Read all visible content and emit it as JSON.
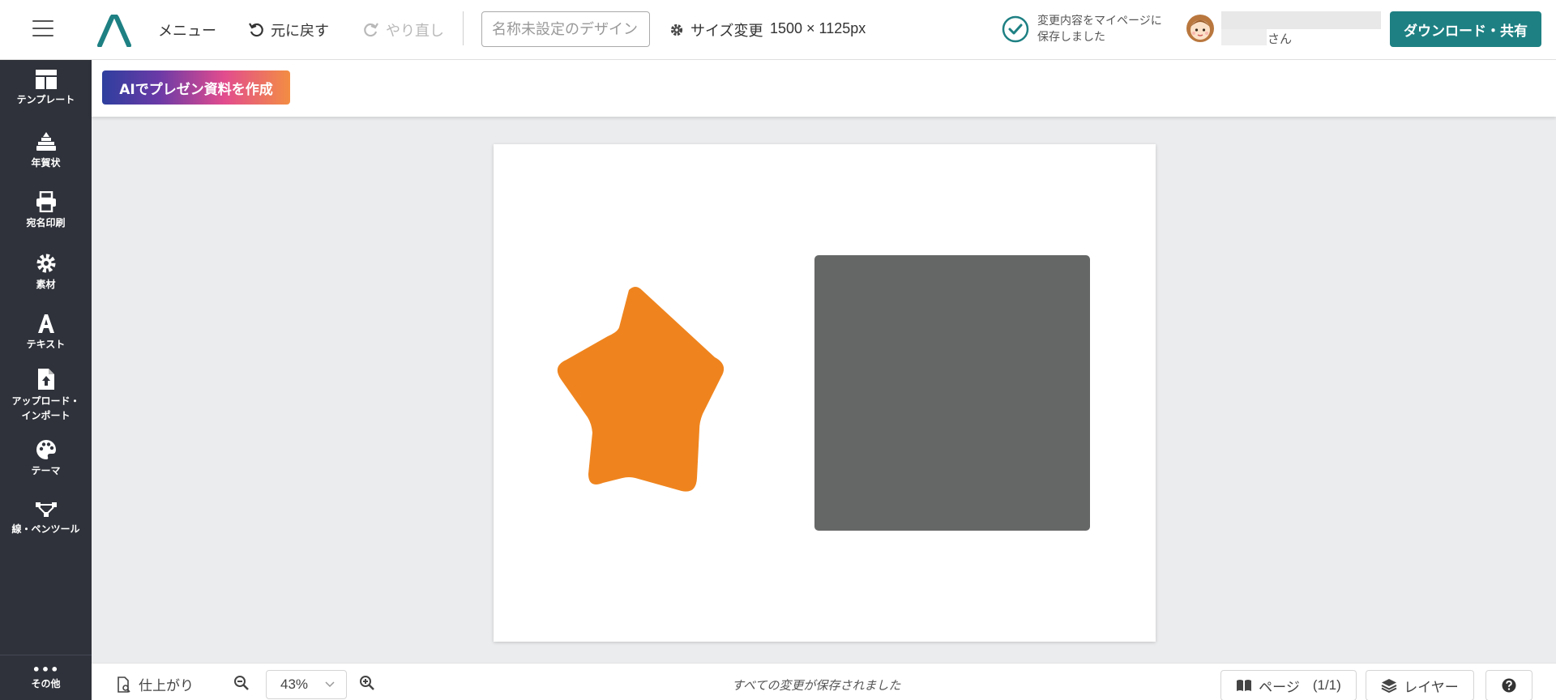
{
  "header": {
    "menu_label": "メニュー",
    "undo_label": "元に戻す",
    "redo_label": "やり直し",
    "design_name_placeholder": "名称未設定のデザイン",
    "size_change_label": "サイズ変更",
    "size_value": "1500 × 1125px",
    "saved_message": "変更内容をマイページに保存しました",
    "user_suffix": "さん",
    "download_label": "ダウンロード・共有"
  },
  "sidebar": {
    "items": [
      {
        "label": "テンプレート",
        "icon": "template-icon"
      },
      {
        "label": "年賀状",
        "icon": "new-year-card-icon"
      },
      {
        "label": "宛名印刷",
        "icon": "printer-icon"
      },
      {
        "label": "素材",
        "icon": "gear-icon"
      },
      {
        "label": "テキスト",
        "icon": "text-icon"
      },
      {
        "label": "アップロード・インポート",
        "icon": "upload-file-icon"
      },
      {
        "label": "テーマ",
        "icon": "palette-icon"
      },
      {
        "label": "線・ペンツール",
        "icon": "pen-tool-icon"
      }
    ],
    "more_label": "その他"
  },
  "subbar": {
    "ai_button_label": "AIでプレゼン資料を作成"
  },
  "canvas": {
    "shapes": [
      {
        "type": "rounded-star",
        "color": "#ef841e"
      },
      {
        "type": "rounded-rect",
        "color": "#656766"
      }
    ]
  },
  "bottombar": {
    "finish_label": "仕上がり",
    "zoom_value": "43%",
    "status": "すべての変更が保存されました",
    "pages_label": "ページ",
    "pages_count": "(1/1)",
    "layer_label": "レイヤー"
  },
  "colors": {
    "accent": "#1e8083",
    "sidebar_bg": "#2f323a",
    "workspace_bg": "#ebecee",
    "star": "#ef841e",
    "rect": "#656766"
  }
}
